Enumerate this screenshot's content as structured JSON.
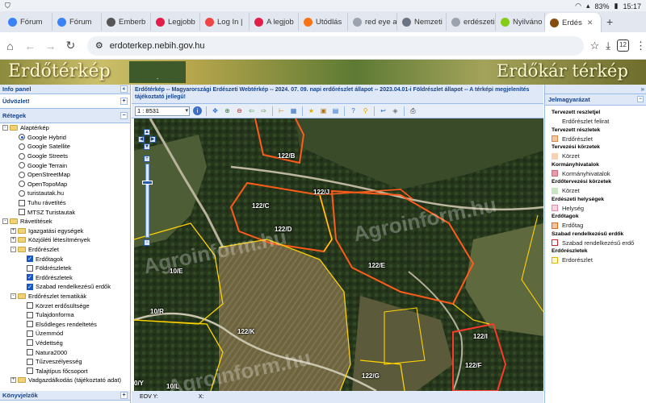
{
  "status_bar": {
    "battery": "83%",
    "time": "15:17"
  },
  "tabs": [
    {
      "label": "Fórum",
      "color": "#3b82f6",
      "active": false
    },
    {
      "label": "Fórum",
      "color": "#3b82f6",
      "active": false
    },
    {
      "label": "Emberb",
      "color": "#555555",
      "active": false
    },
    {
      "label": "Legjobb",
      "color": "#e11d48",
      "active": false
    },
    {
      "label": "Log In |",
      "color": "#ef4444",
      "active": false
    },
    {
      "label": "A legjob",
      "color": "#e11d48",
      "active": false
    },
    {
      "label": "Utódlás",
      "color": "#f97316",
      "active": false
    },
    {
      "label": "red eye a",
      "color": "#9ca3af",
      "active": false
    },
    {
      "label": "Nemzeti",
      "color": "#6b7280",
      "active": false
    },
    {
      "label": "erdészeti",
      "color": "#9ca3af",
      "active": false
    },
    {
      "label": "Nyilváno",
      "color": "#84cc16",
      "active": false
    },
    {
      "label": "Erdés",
      "color": "#854d0e",
      "active": true
    }
  ],
  "address": {
    "url": "erdoterkep.nebih.gov.hu",
    "tab_count": "12"
  },
  "banner": {
    "left_title": "Erdőtérkép",
    "right_title": "Erdőkár térkép"
  },
  "left_panel": {
    "info": "Info panel",
    "welcome": "Üdvözlet!",
    "layers": "Rétegek",
    "bottom": "Könyvjelzők",
    "tree": [
      {
        "kind": "folder",
        "depth": 0,
        "expand": "-",
        "label": "Alaptérkép"
      },
      {
        "kind": "radio",
        "depth": 2,
        "checked": true,
        "label": "Google Hybrid"
      },
      {
        "kind": "radio",
        "depth": 2,
        "checked": false,
        "label": "Google Satellite"
      },
      {
        "kind": "radio",
        "depth": 2,
        "checked": false,
        "label": "Google Streets"
      },
      {
        "kind": "radio",
        "depth": 2,
        "checked": false,
        "label": "Google Terrain"
      },
      {
        "kind": "radio",
        "depth": 2,
        "checked": false,
        "label": "OpenStreetMap"
      },
      {
        "kind": "radio",
        "depth": 2,
        "checked": false,
        "label": "OpenTopoMap"
      },
      {
        "kind": "radio",
        "depth": 2,
        "checked": false,
        "label": "turistautak.hu"
      },
      {
        "kind": "check",
        "depth": 2,
        "checked": false,
        "label": "Tuhu rávetítés"
      },
      {
        "kind": "check",
        "depth": 2,
        "checked": false,
        "label": "MTSZ Turistautak"
      },
      {
        "kind": "folder",
        "depth": 0,
        "expand": "-",
        "label": "Rávetítések"
      },
      {
        "kind": "folder",
        "depth": 1,
        "expand": "+",
        "label": "Igazgatási egységek"
      },
      {
        "kind": "folder",
        "depth": 1,
        "expand": "+",
        "label": "Közjóléti létesítmények"
      },
      {
        "kind": "folder",
        "depth": 1,
        "expand": "-",
        "label": "Erdőrészlet"
      },
      {
        "kind": "check",
        "depth": 3,
        "checked": true,
        "label": "Erdőtagok"
      },
      {
        "kind": "check",
        "depth": 3,
        "checked": false,
        "label": "Földrészletek"
      },
      {
        "kind": "check",
        "depth": 3,
        "checked": true,
        "label": "Erdőrészletek"
      },
      {
        "kind": "check",
        "depth": 3,
        "checked": true,
        "label": "Szabad rendelkezésű erdők"
      },
      {
        "kind": "folder",
        "depth": 1,
        "expand": "-",
        "label": "Erdőrészlet tematikák"
      },
      {
        "kind": "check",
        "depth": 3,
        "checked": false,
        "label": "Körzet erdősültsége"
      },
      {
        "kind": "check",
        "depth": 3,
        "checked": false,
        "label": "Tulajdonforma"
      },
      {
        "kind": "check",
        "depth": 3,
        "checked": false,
        "label": "Elsődleges rendeltetés"
      },
      {
        "kind": "check",
        "depth": 3,
        "checked": false,
        "label": "Üzemmód"
      },
      {
        "kind": "check",
        "depth": 3,
        "checked": false,
        "label": "Védettség"
      },
      {
        "kind": "check",
        "depth": 3,
        "checked": false,
        "label": "Natura2000"
      },
      {
        "kind": "check",
        "depth": 3,
        "checked": false,
        "label": "Tűzveszélyesség"
      },
      {
        "kind": "check",
        "depth": 3,
        "checked": false,
        "label": "Talajtípus főcsoport"
      },
      {
        "kind": "folder",
        "depth": 1,
        "expand": "+",
        "label": "Vadgazdálkodás (tájékoztató adat)"
      }
    ]
  },
  "center": {
    "header": "Erdőtérkép -- Magyarországi Erdészeti Webtérkép -- 2024. 07. 09. napi erdőrészlet állapot -- 2023.04.01-i Földrészlet állapot -- A térképi megjelenítés tájékoztató jellegű!",
    "scale": "1 : 8531",
    "footer_eov": "EOV Y:",
    "footer_x": "X:",
    "watermark": "Agroinform.hu"
  },
  "map_labels": [
    {
      "text": "122/B"
    },
    {
      "text": "122/J"
    },
    {
      "text": "122/C"
    },
    {
      "text": "122/D"
    },
    {
      "text": "122/E"
    },
    {
      "text": "10/E"
    },
    {
      "text": "10/R"
    },
    {
      "text": "122/K"
    },
    {
      "text": "122/I"
    },
    {
      "text": "122/F"
    },
    {
      "text": "122/G"
    },
    {
      "text": "10/L"
    },
    {
      "text": "0/Y"
    }
  ],
  "legend": {
    "title": "Jelmagyarázat",
    "items": [
      {
        "kind": "group",
        "label": "Tervezett reszletjel"
      },
      {
        "kind": "item",
        "label": "Erdőrészlet felirat",
        "swatch": "none"
      },
      {
        "kind": "group",
        "label": "Tervezett részletek"
      },
      {
        "kind": "item",
        "label": "Erdőrészlet",
        "swatch": "#f2c7a6",
        "border": "#d98a4a"
      },
      {
        "kind": "group",
        "label": "Tervezési körzetek"
      },
      {
        "kind": "item",
        "label": "Körzet",
        "swatch": "#f7d2b3",
        "border": "#f7d2b3"
      },
      {
        "kind": "group",
        "label": "Kormányhivatalok"
      },
      {
        "kind": "item",
        "label": "Kormányhivatalok",
        "swatch": "#e89aa8",
        "border": "#d06a7c"
      },
      {
        "kind": "group",
        "label": "Erdőtervezési körzetek"
      },
      {
        "kind": "item",
        "label": "Körzet",
        "swatch": "#c9e6c2",
        "border": "#c9e6c2"
      },
      {
        "kind": "group",
        "label": "Erdészeti helységek"
      },
      {
        "kind": "item",
        "label": "Helység",
        "swatch": "#f9d3e2",
        "border": "#e58aa8"
      },
      {
        "kind": "group",
        "label": "Erdőtagok"
      },
      {
        "kind": "item",
        "label": "Erdőtag",
        "swatch": "#f4c6a0",
        "border": "#e06a1a"
      },
      {
        "kind": "group",
        "label": "Szabad rendelkezésű erdők"
      },
      {
        "kind": "item",
        "label": "Szabad rendelkezésű erdő",
        "swatch": "#ffffff",
        "border": "#d0202a"
      },
      {
        "kind": "group",
        "label": "Erdőrészletek"
      },
      {
        "kind": "item",
        "label": "Erdorészlet",
        "swatch": "#fff6c8",
        "border": "#e6b400"
      }
    ]
  }
}
